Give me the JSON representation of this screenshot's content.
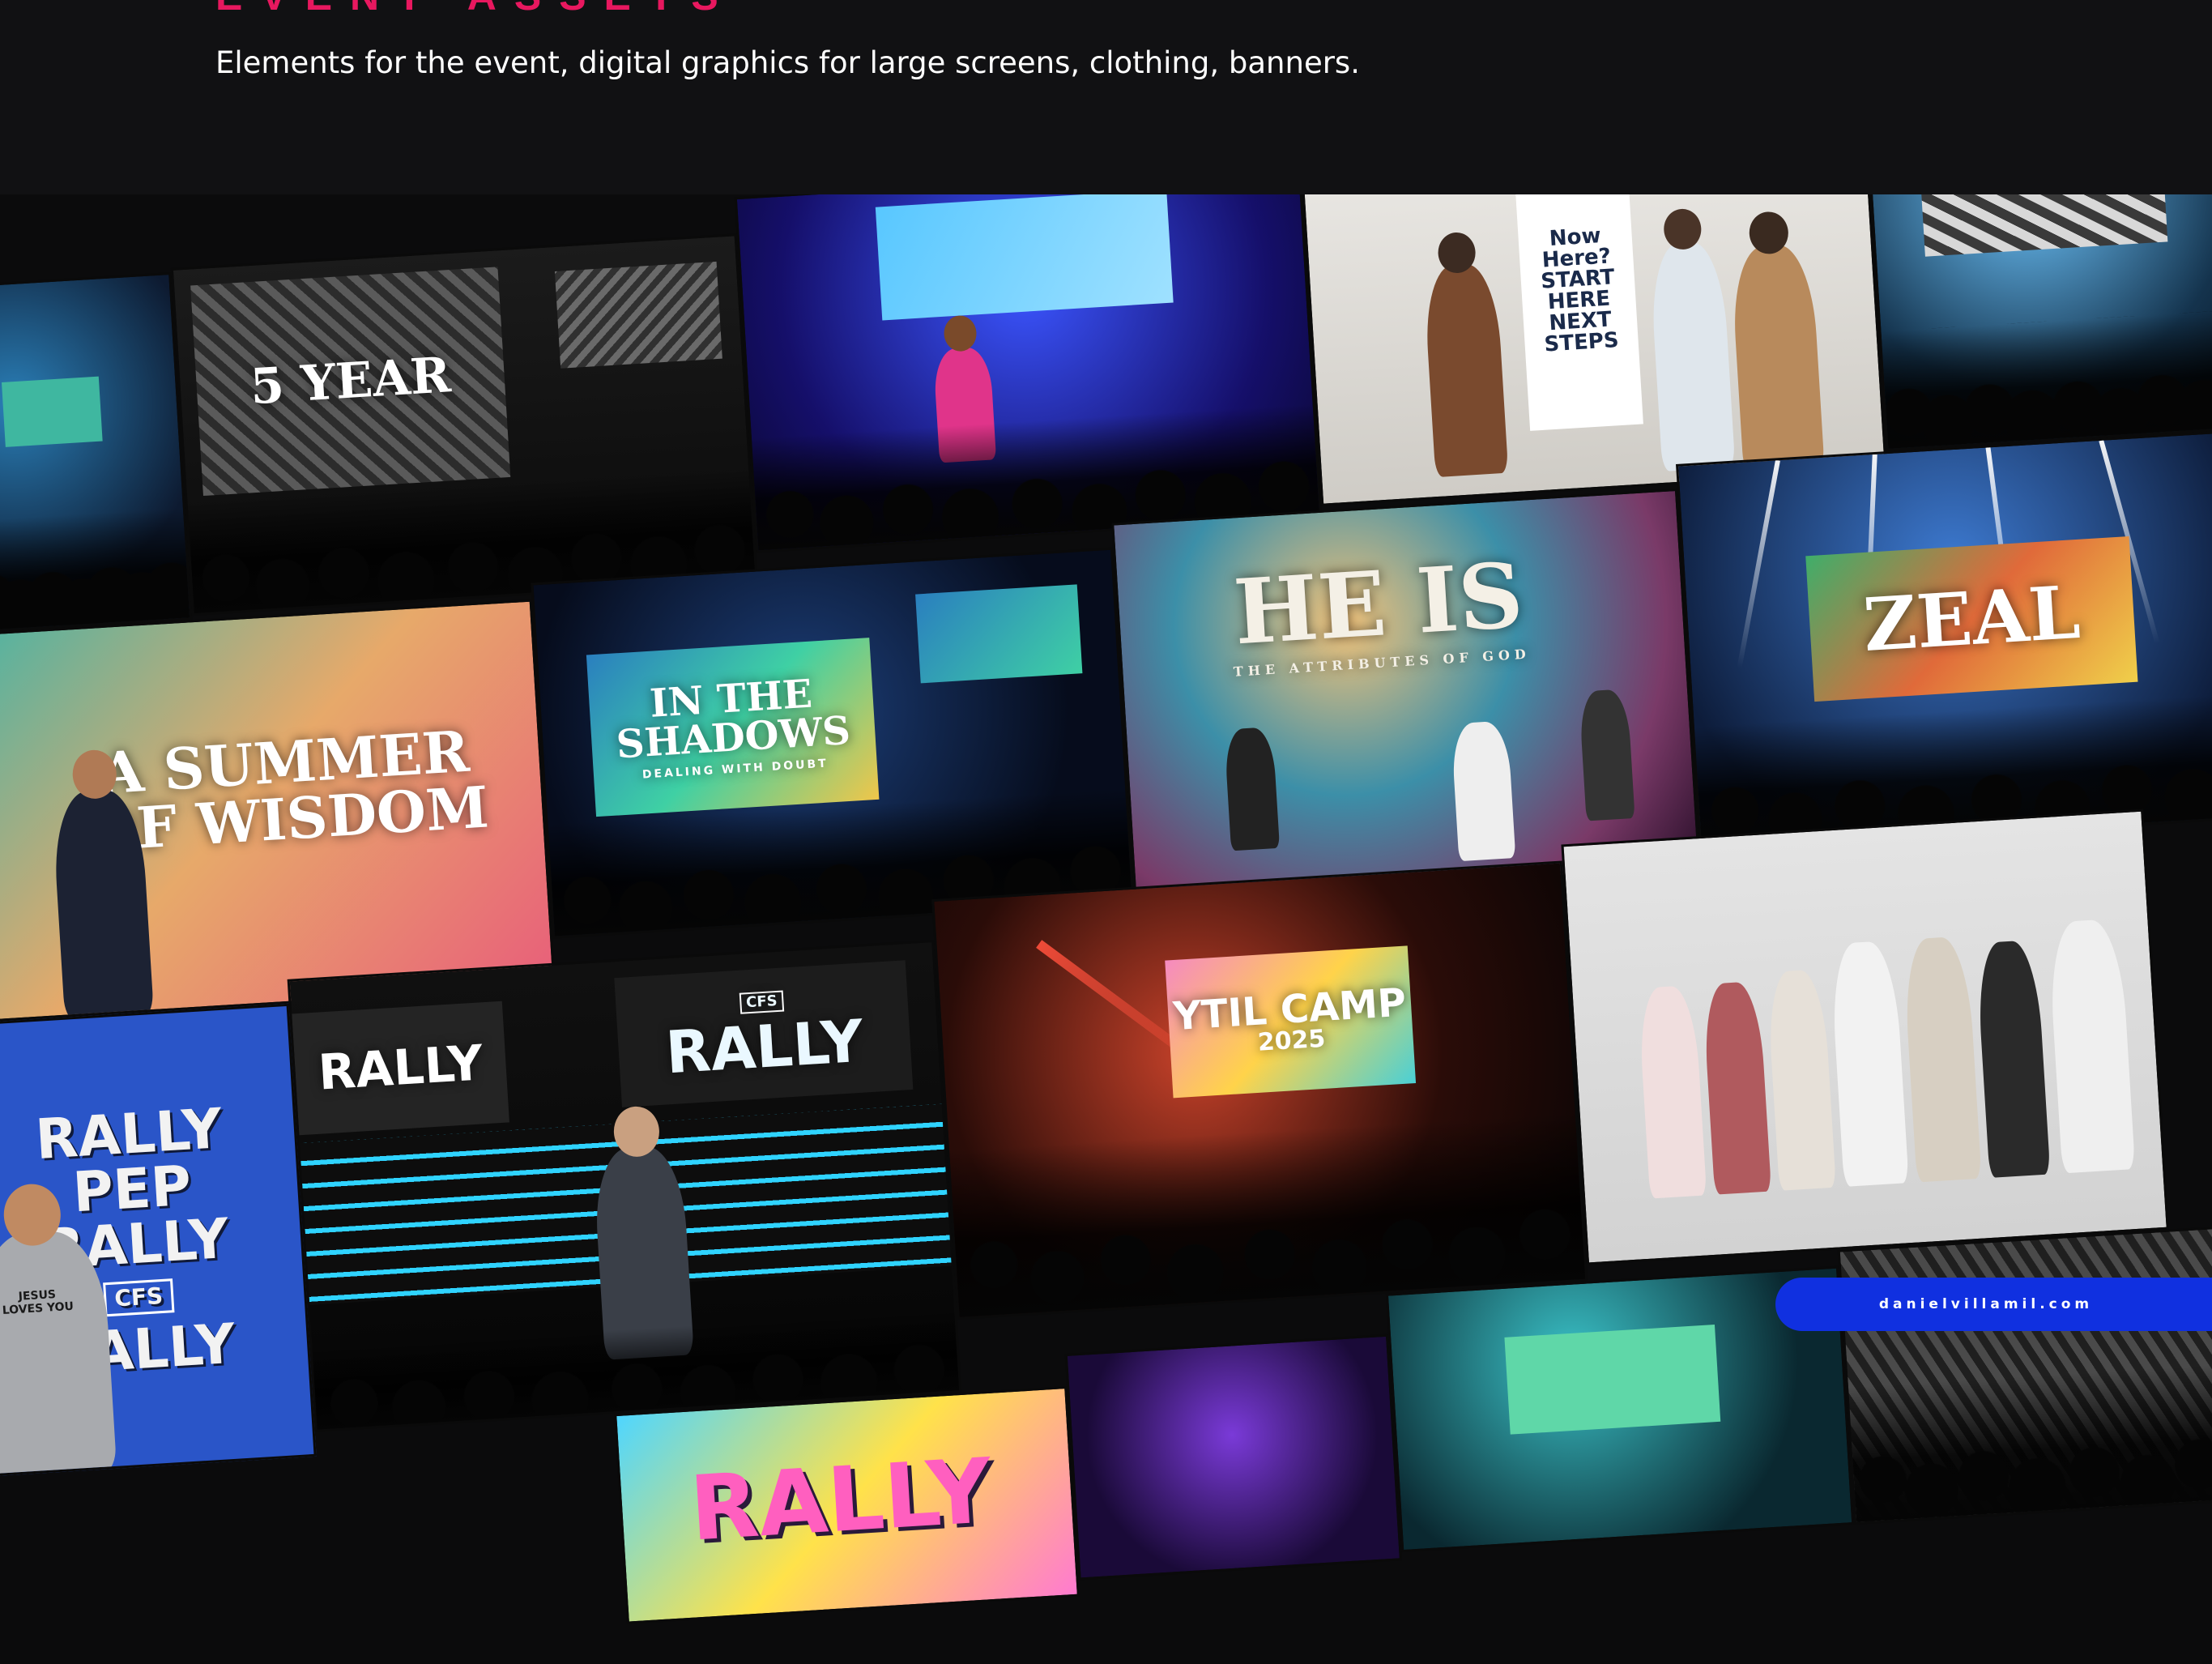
{
  "header": {
    "eyebrow": "EVENT ASSETS",
    "subtitle": "Elements for the event, digital graphics for large screens, clothing, banners."
  },
  "colors": {
    "accent": "#e8185f",
    "background": "#111113",
    "badge": "#1030e0"
  },
  "tiles": {
    "five_year": "5 YEAR",
    "in_the_shadows": "IN THE SHADOWS",
    "in_the_shadows_sub": "DEALING WITH DOUBT",
    "he_is": "HE IS",
    "he_is_sub": "THE ATTRIBUTES OF GOD",
    "zeal": "ZEAL",
    "summer_wisdom": "A SUMMER OF WISDOM",
    "rally": "RALLY",
    "pep_rally": "PEP RALLY",
    "cfs": "CFS",
    "ytil_camp": "YTIL CAMP",
    "ytil_year": "2025",
    "next_steps": "Now Here? START HERE NEXT STEPS",
    "shirt_text": "JESUS LOVES YOU"
  },
  "footer": {
    "site": "danielvillamil.com"
  }
}
